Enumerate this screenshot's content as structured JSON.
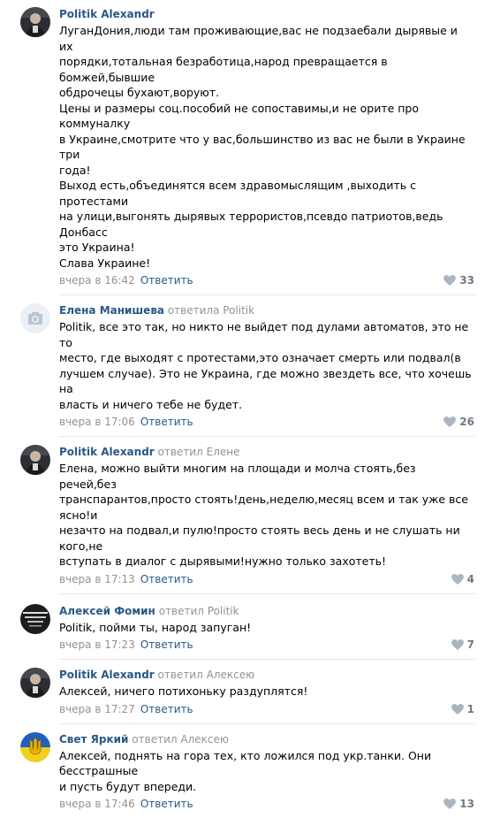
{
  "comments": [
    {
      "author": "Politik Alexandr",
      "replied": "",
      "reply_to": "",
      "text": "ЛуганДония,люди там проживающие,вас не подзаебали дырявые и их\nпорядки,тотальная безработица,народ превращается в бомжей,бывшие\nобдрочецы бухают,воруют.\nЦены и размеры соц.пособий не сопоставимы,и не орите про коммуналку\nв Украине,смотрите что у вас,большинство из вас не были в Украине три\nгода!\nВыход есть,объединятся всем здравомыслящим ,выходить с протестами\nна улици,выгонять дырявых террористов,псевдо патриотов,ведь Донбасс\nэто Украина!\nСлава Украине!",
      "time": "вчера в 16:42",
      "reply_label": "Ответить",
      "likes": "33",
      "avatar": "portrait"
    },
    {
      "author": "Елена Манишева",
      "replied": "ответила",
      "reply_to": "Politik",
      "text": "Politik, все это так, но никто не выйдет под дулами автоматов, это не то\nместо, где выходят с протестами,это означает смерть или подвал(в\nлучшем случае). Это не Украина, где можно звездеть все, что хочешь на\nвласть и ничего тебе не будет.",
      "time": "вчера в 17:06",
      "reply_label": "Ответить",
      "likes": "26",
      "avatar": "camera"
    },
    {
      "author": "Politik Alexandr",
      "replied": "ответил",
      "reply_to": "Елене",
      "text": "Елена, можно выйти многим на площади и молча стоять,без речей,без\nтранспарантов,просто стоять!день,неделю,месяц всем и так уже все ясно!и\nнезачто на подвал,и пулю!просто стоять весь день и не слушать ни кого,не\nвступать в диалог с дырявыми!нужно только захотеть!",
      "time": "вчера в 17:13",
      "reply_label": "Ответить",
      "likes": "4",
      "avatar": "portrait"
    },
    {
      "author": "Алексей Фомин",
      "replied": "ответил",
      "reply_to": "Politik",
      "text": "Politik, пойми ты, народ запуган!",
      "time": "вчера в 17:23",
      "reply_label": "Ответить",
      "likes": "7",
      "avatar": "poster"
    },
    {
      "author": "Politik Alexandr",
      "replied": "ответил",
      "reply_to": "Алексею",
      "text": "Алексей, ничего потихоньку раздуплятся!",
      "time": "вчера в 17:27",
      "reply_label": "Ответить",
      "likes": "1",
      "avatar": "portrait"
    },
    {
      "author": "Свет Яркий",
      "replied": "ответил",
      "reply_to": "Алексею",
      "text": "Алексей, поднять на гора тех, кто ложился под укр.танки. Они бесстрашные\nи пусть будут впереди.",
      "time": "вчера в 17:46",
      "reply_label": "Ответить",
      "likes": "13",
      "avatar": "trident"
    }
  ]
}
